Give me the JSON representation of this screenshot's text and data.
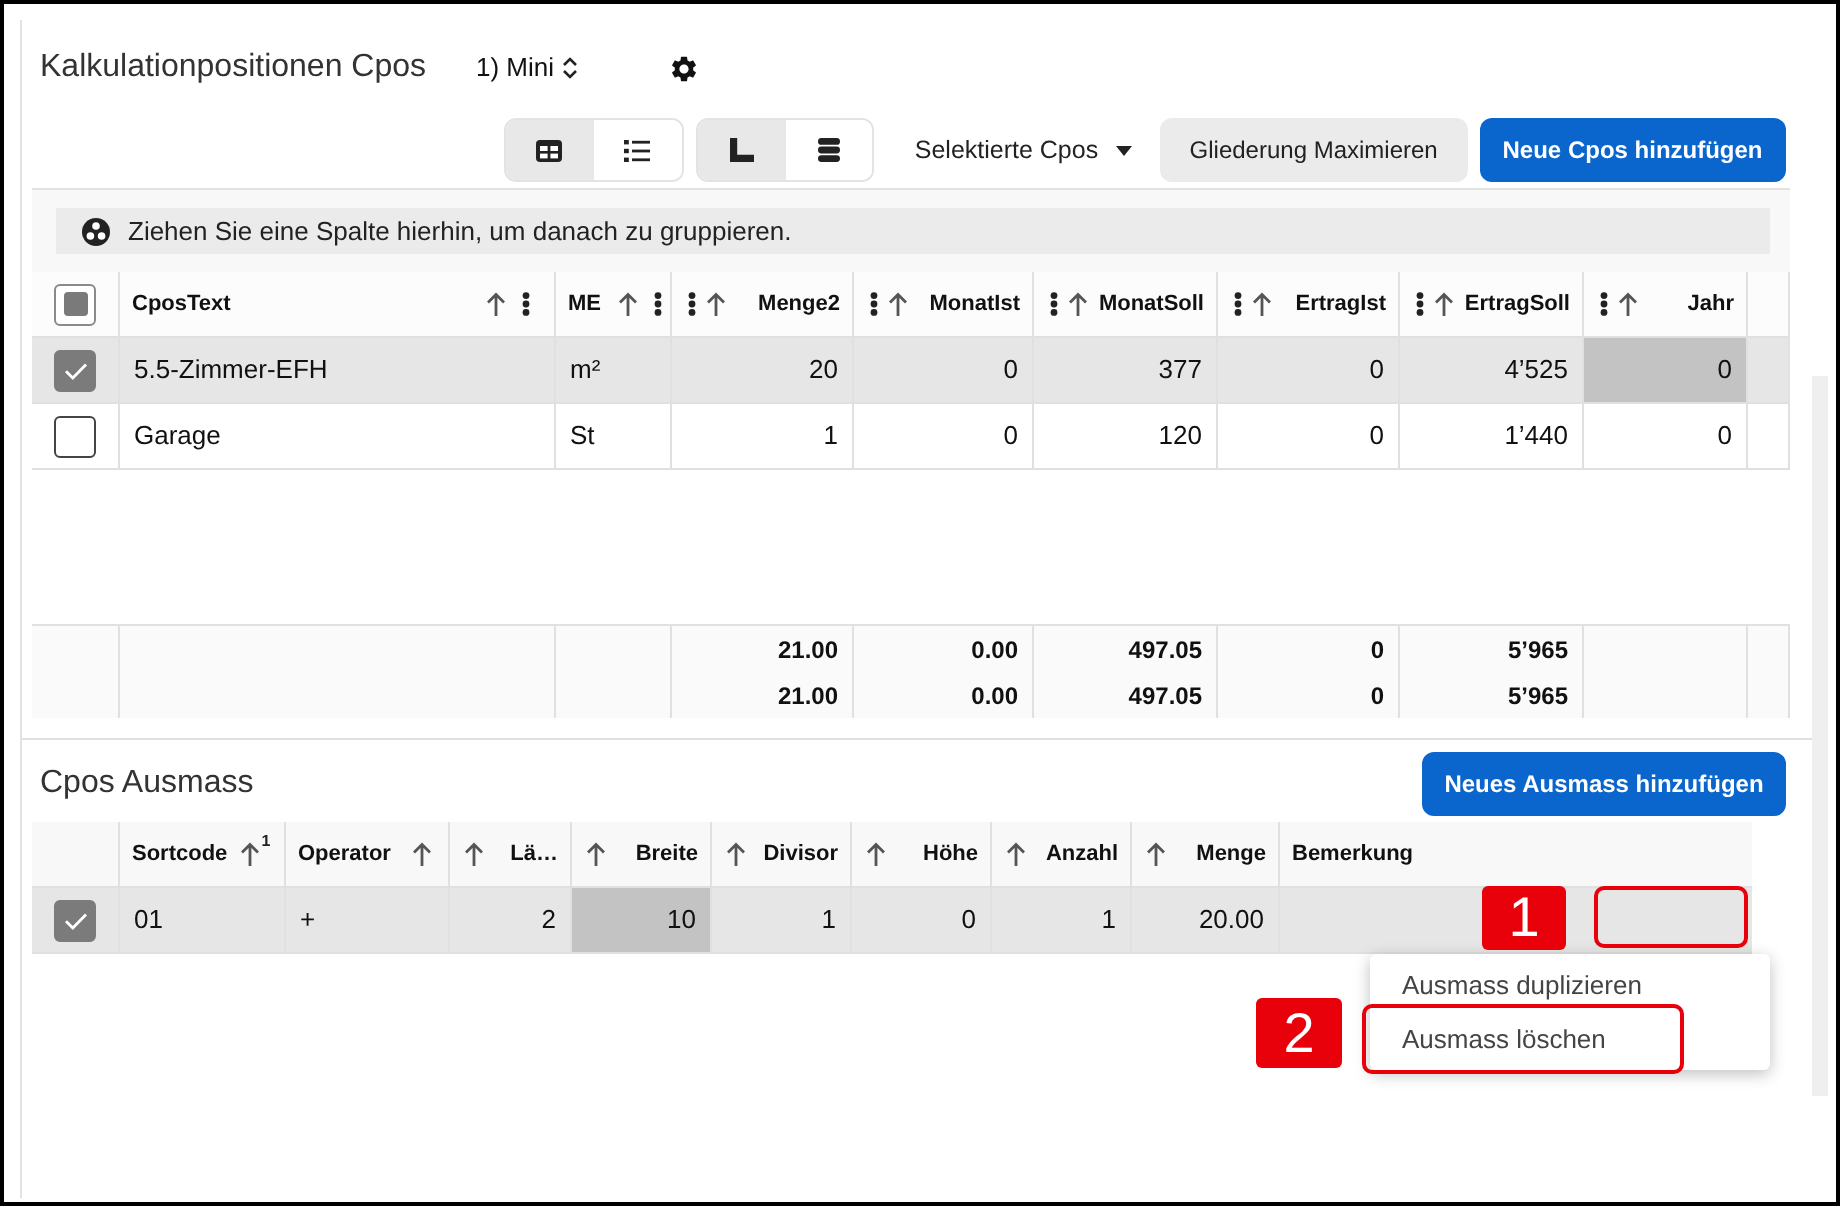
{
  "header": {
    "title": "Kalkulationpositionen Cpos",
    "layout_picker": "1) Mini"
  },
  "toolbar": {
    "toggle_groups": [
      {
        "buttons": [
          {
            "selected": true
          },
          {
            "selected": false
          }
        ]
      },
      {
        "buttons": [
          {
            "selected": true
          },
          {
            "selected": false
          }
        ]
      }
    ],
    "selection_menu": "Selektierte Cpos",
    "buttons": [
      {
        "label": "Gliederung Maximieren",
        "kind": "secondary"
      },
      {
        "label": "Neue Cpos hinzufügen",
        "kind": "primary"
      }
    ]
  },
  "group_panel": {
    "hint": "Ziehen Sie eine Spalte hierhin, um danach zu gruppieren."
  },
  "positions_table": {
    "column_menus": true,
    "select_all": {
      "indeterminate": true
    },
    "columns": [
      {
        "label": "CposText",
        "kind": "text",
        "sortable": true
      },
      {
        "label": "ME",
        "kind": "text",
        "sortable": true
      },
      {
        "label": "Menge2",
        "kind": "number",
        "sortable": true
      },
      {
        "label": "MonatIst",
        "kind": "number",
        "sortable": true
      },
      {
        "label": "MonatSoll",
        "kind": "number",
        "sortable": true
      },
      {
        "label": "ErtragIst",
        "kind": "number",
        "sortable": true
      },
      {
        "label": "ErtragSoll",
        "kind": "number",
        "sortable": true
      },
      {
        "label": "Jahr",
        "kind": "number",
        "sortable": true
      }
    ],
    "rows": [
      {
        "selected": true,
        "cells": [
          {
            "text": "5.5-Zimmer-EFH",
            "focused": false
          },
          {
            "text": "m²",
            "focused": false
          },
          {
            "text": "20",
            "focused": false
          },
          {
            "text": "0",
            "focused": false
          },
          {
            "text": "377",
            "focused": false
          },
          {
            "text": "0",
            "focused": false
          },
          {
            "text": "4’525",
            "focused": false
          },
          {
            "text": "0",
            "focused": true
          }
        ]
      },
      {
        "selected": false,
        "cells": [
          {
            "text": "Garage",
            "focused": false
          },
          {
            "text": "St",
            "focused": false
          },
          {
            "text": "1",
            "focused": false
          },
          {
            "text": "0",
            "focused": false
          },
          {
            "text": "120",
            "focused": false
          },
          {
            "text": "0",
            "focused": false
          },
          {
            "text": "1’440",
            "focused": false
          },
          {
            "text": "0",
            "focused": false
          }
        ]
      }
    ],
    "totals": [
      [
        "21.00",
        "0.00",
        "497.05",
        "0",
        "5’965"
      ],
      [
        "21.00",
        "0.00",
        "497.05",
        "0",
        "5’965"
      ]
    ]
  },
  "measurements": {
    "title": "Cpos Ausmass",
    "add_button": "Neues Ausmass hinzufügen",
    "table": {
      "column_menus": false,
      "columns": [
        {
          "label": "Sortcode",
          "kind": "text",
          "sortable": true,
          "sort_order": "1"
        },
        {
          "label": "Operator",
          "kind": "text",
          "sortable": true
        },
        {
          "label": "Lä…",
          "kind": "number",
          "sortable": true
        },
        {
          "label": "Breite",
          "kind": "number",
          "sortable": true
        },
        {
          "label": "Divisor",
          "kind": "number",
          "sortable": true
        },
        {
          "label": "Höhe",
          "kind": "number",
          "sortable": true
        },
        {
          "label": "Anzahl",
          "kind": "number",
          "sortable": true
        },
        {
          "label": "Menge",
          "kind": "number",
          "sortable": true
        },
        {
          "label": "Bemerkung",
          "kind": "text",
          "sortable": false
        }
      ],
      "rows": [
        {
          "selected": true,
          "cells": [
            {
              "text": "01",
              "focused": false
            },
            {
              "text": "+",
              "focused": false
            },
            {
              "text": "2",
              "focused": false
            },
            {
              "text": "10",
              "focused": true
            },
            {
              "text": "1",
              "focused": false
            },
            {
              "text": "0",
              "focused": false
            },
            {
              "text": "1",
              "focused": false
            },
            {
              "text": "20.00",
              "focused": false
            }
          ]
        }
      ]
    }
  },
  "context_menu": {
    "items": [
      {
        "label": "Ausmass duplizieren"
      },
      {
        "label": "Ausmass löschen"
      }
    ]
  },
  "annotations": [
    {
      "label": "1"
    },
    {
      "label": "2"
    }
  ]
}
